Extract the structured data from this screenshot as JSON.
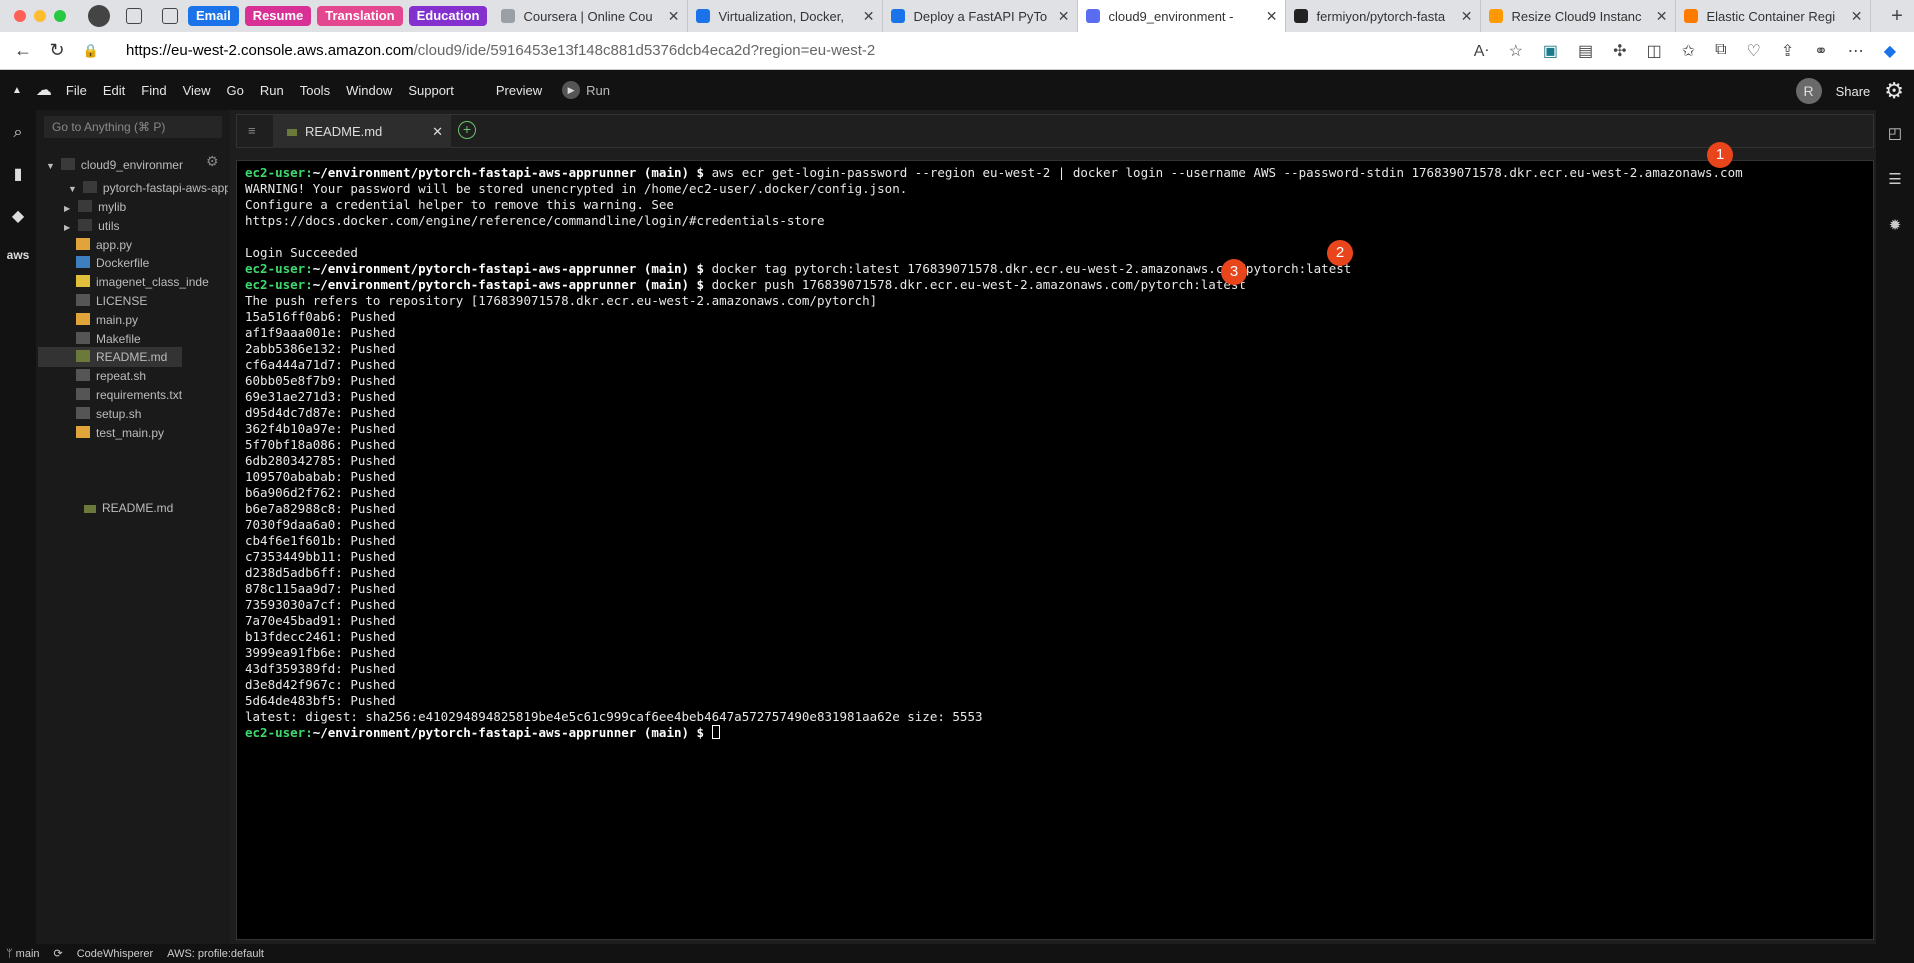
{
  "browser": {
    "groups": [
      {
        "label": "Email",
        "color": "#1a73e8"
      },
      {
        "label": "Resume",
        "color": "#d93095"
      },
      {
        "label": "Translation",
        "color": "#e4468f"
      },
      {
        "label": "Education",
        "color": "#8430ce"
      }
    ],
    "tabs": [
      {
        "title": "Coursera | Online Cou",
        "fav": "#9aa0a6"
      },
      {
        "title": "Virtualization, Docker,",
        "fav": "#1a73e8"
      },
      {
        "title": "Deploy a FastAPI PyTo",
        "fav": "#1a73e8"
      },
      {
        "title": "cloud9_environment -",
        "fav": "#5a6cf0",
        "active": true
      },
      {
        "title": "fermiyon/pytorch-fasta",
        "fav": "#222222"
      },
      {
        "title": "Resize Cloud9 Instanc",
        "fav": "#ff9900"
      },
      {
        "title": "Elastic Container Regi",
        "fav": "#ff7a00"
      }
    ],
    "url_host": "https://eu-west-2.console.aws.amazon.com",
    "url_path": "/cloud9/ide/5916453e13f148c881d5376dcb4eca2d?region=eu-west-2"
  },
  "menubar": {
    "items": [
      "File",
      "Edit",
      "Find",
      "View",
      "Go",
      "Run",
      "Tools",
      "Window",
      "Support"
    ],
    "preview": "Preview",
    "run": "Run",
    "avatar": "R",
    "share": "Share"
  },
  "sidebar": {
    "goto_placeholder": "Go to Anything (⌘ P)",
    "root": "cloud9_environmer",
    "project": "pytorch-fastapi-aws-app",
    "items": [
      {
        "label": "mylib",
        "type": "folder"
      },
      {
        "label": "utils",
        "type": "folder"
      },
      {
        "label": "app.py",
        "type": "py"
      },
      {
        "label": "Dockerfile",
        "type": "docker"
      },
      {
        "label": "imagenet_class_inde",
        "type": "json"
      },
      {
        "label": "LICENSE",
        "type": "txt"
      },
      {
        "label": "main.py",
        "type": "py"
      },
      {
        "label": "Makefile",
        "type": "sh"
      },
      {
        "label": "README.md",
        "type": "md"
      },
      {
        "label": "repeat.sh",
        "type": "sh"
      },
      {
        "label": "requirements.txt",
        "type": "txt"
      },
      {
        "label": "setup.sh",
        "type": "sh"
      },
      {
        "label": "test_main.py",
        "type": "py"
      }
    ],
    "root_readme": "README.md"
  },
  "editor": {
    "tab_label": "README.md"
  },
  "terminal": {
    "prompt_user": "ec2-user:",
    "prompt_path": "~/environment/pytorch-fastapi-aws-apprunner",
    "prompt_tail": " (main) $ ",
    "cmd1": "aws ecr get-login-password --region eu-west-2 | docker login --username AWS --password-stdin 176839071578.dkr.ecr.eu-west-2.amazonaws.com",
    "out1": [
      "WARNING! Your password will be stored unencrypted in /home/ec2-user/.docker/config.json.",
      "Configure a credential helper to remove this warning. See",
      "https://docs.docker.com/engine/reference/commandline/login/#credentials-store",
      "",
      "Login Succeeded"
    ],
    "cmd2": "docker tag pytorch:latest 176839071578.dkr.ecr.eu-west-2.amazonaws.com/pytorch:latest",
    "cmd3": "docker push 176839071578.dkr.ecr.eu-west-2.amazonaws.com/pytorch:latest",
    "push_ref": "The push refers to repository [176839071578.dkr.ecr.eu-west-2.amazonaws.com/pytorch]",
    "layers": [
      "15a516ff0ab6: Pushed",
      "af1f9aaa001e: Pushed",
      "2abb5386e132: Pushed",
      "cf6a444a71d7: Pushed",
      "60bb05e8f7b9: Pushed",
      "69e31ae271d3: Pushed",
      "d95d4dc7d87e: Pushed",
      "362f4b10a97e: Pushed",
      "5f70bf18a086: Pushed",
      "6db280342785: Pushed",
      "109570ababab: Pushed",
      "b6a906d2f762: Pushed",
      "b6e7a82988c8: Pushed",
      "7030f9daa6a0: Pushed",
      "cb4f6e1f601b: Pushed",
      "c7353449bb11: Pushed",
      "d238d5adb6ff: Pushed",
      "878c115aa9d7: Pushed",
      "73593030a7cf: Pushed",
      "7a70e45bad91: Pushed",
      "b13fdecc2461: Pushed",
      "3999ea91fb6e: Pushed",
      "43df359389fd: Pushed",
      "d3e8d42f967c: Pushed",
      "5d64de483bf5: Pushed"
    ],
    "digest": "latest: digest: sha256:e410294894825819be4e5c61c999caf6ee4beb4647a572757490e831981aa62e size: 5553"
  },
  "annotations": [
    "1",
    "2",
    "3"
  ],
  "statusbar": {
    "branch": "main",
    "codewhisperer": "CodeWhisperer",
    "profile": "AWS: profile:default"
  }
}
